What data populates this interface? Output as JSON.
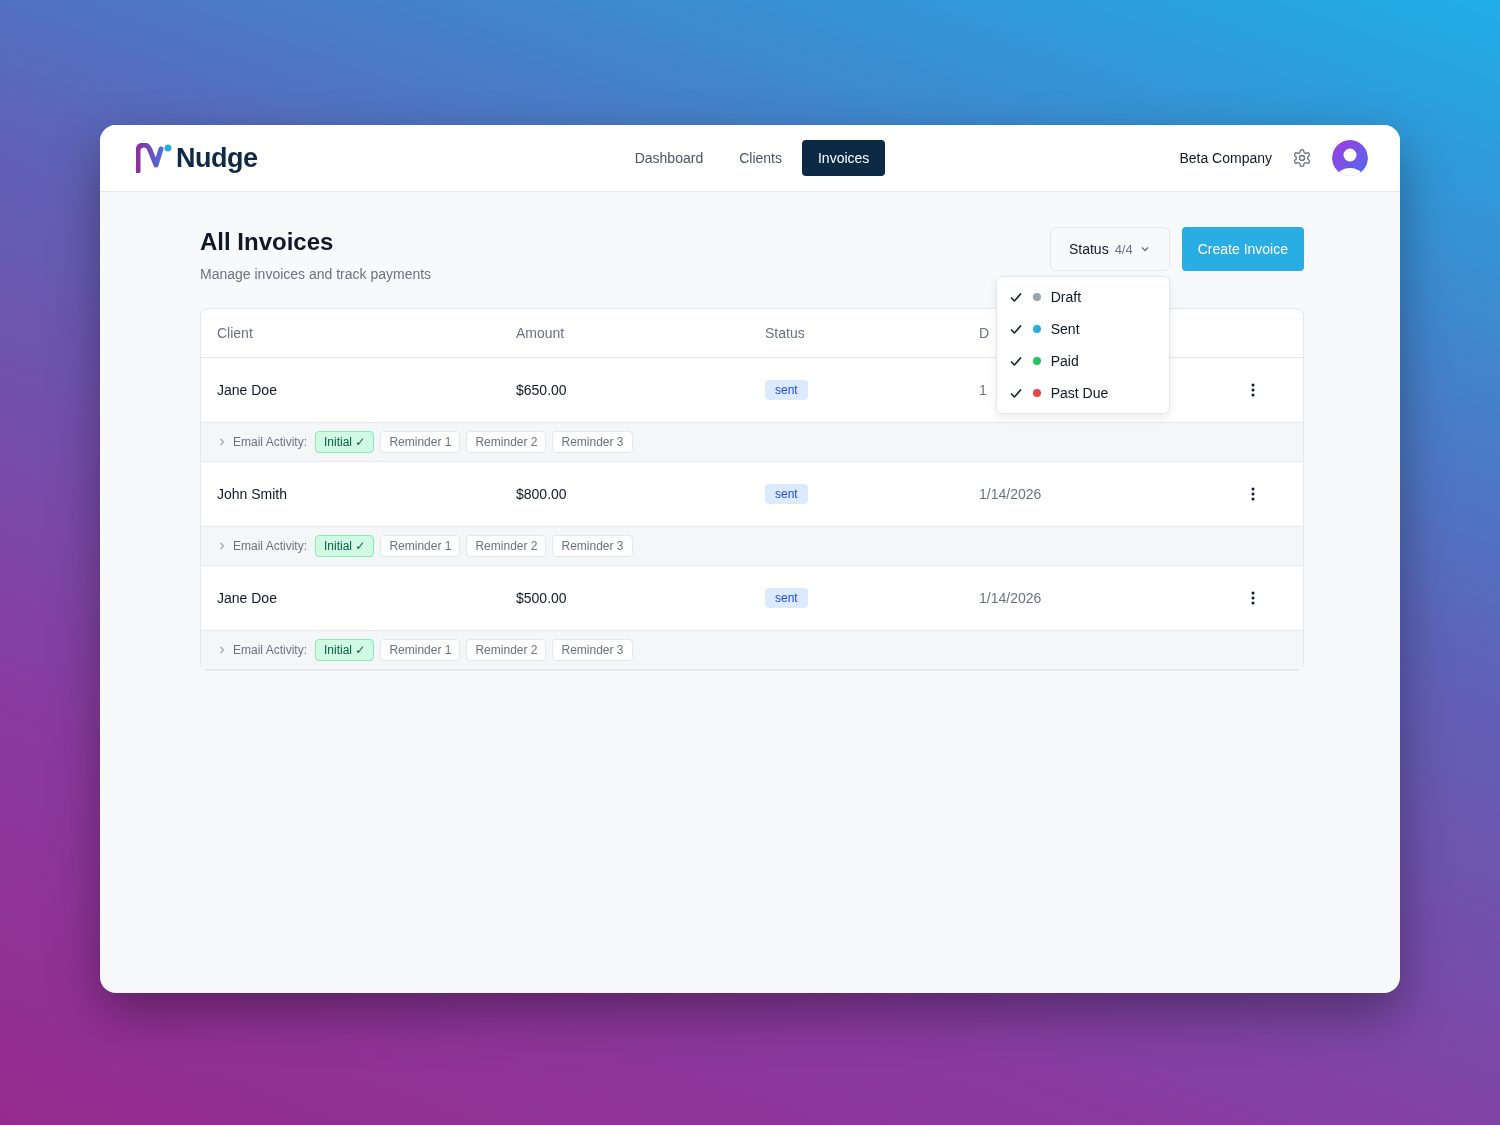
{
  "brand": {
    "name": "Nudge"
  },
  "nav": [
    {
      "label": "Dashboard",
      "selected": false
    },
    {
      "label": "Clients",
      "selected": false
    },
    {
      "label": "Invoices",
      "selected": true
    }
  ],
  "company": "Beta Company",
  "page": {
    "title": "All Invoices",
    "subtitle": "Manage invoices and track payments"
  },
  "filter": {
    "label": "Status",
    "count": "4/4",
    "expanded": true,
    "options": [
      {
        "label": "Draft",
        "checked": true,
        "color": "#9ca3af"
      },
      {
        "label": "Sent",
        "checked": true,
        "color": "#29aee3"
      },
      {
        "label": "Paid",
        "checked": true,
        "color": "#22c55e"
      },
      {
        "label": "Past Due",
        "checked": true,
        "color": "#ef4444"
      }
    ]
  },
  "create_button": "Create Invoice",
  "table": {
    "columns": [
      "Client",
      "Amount",
      "Status",
      "D"
    ],
    "rows": [
      {
        "client": "Jane Doe",
        "amount": "$650.00",
        "status": "sent",
        "date": "1",
        "activity_label": "Email Activity:",
        "emails": [
          {
            "label": "Initial ✓",
            "sent": true
          },
          {
            "label": "Reminder 1",
            "sent": false
          },
          {
            "label": "Reminder 2",
            "sent": false
          },
          {
            "label": "Reminder 3",
            "sent": false
          }
        ]
      },
      {
        "client": "John Smith",
        "amount": "$800.00",
        "status": "sent",
        "date": "1/14/2026",
        "activity_label": "Email Activity:",
        "emails": [
          {
            "label": "Initial ✓",
            "sent": true
          },
          {
            "label": "Reminder 1",
            "sent": false
          },
          {
            "label": "Reminder 2",
            "sent": false
          },
          {
            "label": "Reminder 3",
            "sent": false
          }
        ]
      },
      {
        "client": "Jane Doe",
        "amount": "$500.00",
        "status": "sent",
        "date": "1/14/2026",
        "activity_label": "Email Activity:",
        "emails": [
          {
            "label": "Initial ✓",
            "sent": true
          },
          {
            "label": "Reminder 1",
            "sent": false
          },
          {
            "label": "Reminder 2",
            "sent": false
          },
          {
            "label": "Reminder 3",
            "sent": false
          }
        ]
      }
    ]
  }
}
